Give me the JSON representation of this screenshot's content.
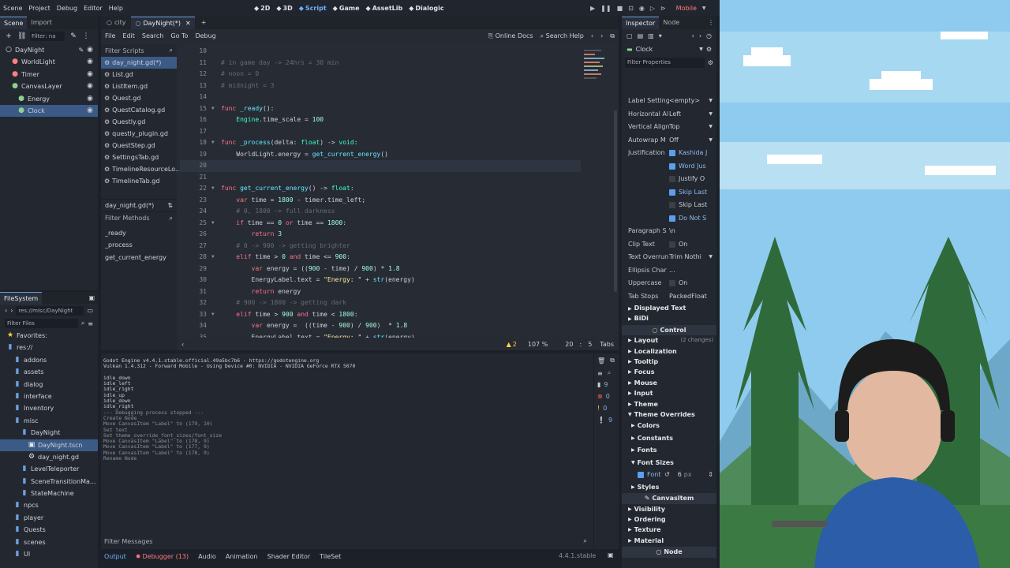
{
  "menu": [
    "Scene",
    "Project",
    "Debug",
    "Editor",
    "Help"
  ],
  "workspaces": [
    {
      "label": "2D",
      "icon": "2d-icon"
    },
    {
      "label": "3D",
      "icon": "3d-icon"
    },
    {
      "label": "Script",
      "icon": "script-icon",
      "active": true
    },
    {
      "label": "Game",
      "icon": "game-icon"
    },
    {
      "label": "AssetLib",
      "icon": "assetlib-icon"
    },
    {
      "label": "Dialogic",
      "icon": "dialogic-icon"
    }
  ],
  "renderer": "Mobile",
  "scene_dock": {
    "tabs": [
      "Scene",
      "Import"
    ],
    "filter_placeholder": "Filter: na",
    "tree": [
      {
        "label": "DayNight",
        "depth": 0,
        "icon": "node-icon"
      },
      {
        "label": "WorldLight",
        "depth": 1,
        "icon": "light-icon"
      },
      {
        "label": "Timer",
        "depth": 1,
        "icon": "timer-icon"
      },
      {
        "label": "CanvasLayer",
        "depth": 1,
        "icon": "canvaslayer-icon"
      },
      {
        "label": "Energy",
        "depth": 2,
        "icon": "label-icon"
      },
      {
        "label": "Clock",
        "depth": 2,
        "icon": "label-icon",
        "selected": true
      }
    ]
  },
  "filesystem": {
    "title": "FileSystem",
    "path": "res://misc/DayNight",
    "filter_placeholder": "Filter Files",
    "items": [
      {
        "label": "Favorites:",
        "depth": 0,
        "icon": "star-icon"
      },
      {
        "label": "res://",
        "depth": 0,
        "icon": "folder-icon"
      },
      {
        "label": "addons",
        "depth": 1,
        "icon": "folder-icon"
      },
      {
        "label": "assets",
        "depth": 1,
        "icon": "folder-icon"
      },
      {
        "label": "dialog",
        "depth": 1,
        "icon": "folder-icon"
      },
      {
        "label": "interface",
        "depth": 1,
        "icon": "folder-icon"
      },
      {
        "label": "Inventory",
        "depth": 1,
        "icon": "folder-icon"
      },
      {
        "label": "misc",
        "depth": 1,
        "icon": "folder-icon"
      },
      {
        "label": "DayNight",
        "depth": 2,
        "icon": "folder-icon"
      },
      {
        "label": "DayNight.tscn",
        "depth": 3,
        "icon": "scene-icon",
        "selected": true
      },
      {
        "label": "day_night.gd",
        "depth": 3,
        "icon": "script-file-icon"
      },
      {
        "label": "LevelTeleporter",
        "depth": 2,
        "icon": "folder-icon"
      },
      {
        "label": "SceneTransitionMa...",
        "depth": 2,
        "icon": "folder-icon"
      },
      {
        "label": "StateMachine",
        "depth": 2,
        "icon": "folder-icon"
      },
      {
        "label": "npcs",
        "depth": 1,
        "icon": "folder-icon"
      },
      {
        "label": "player",
        "depth": 1,
        "icon": "folder-icon"
      },
      {
        "label": "Quests",
        "depth": 1,
        "icon": "folder-icon"
      },
      {
        "label": "scenes",
        "depth": 1,
        "icon": "folder-icon"
      },
      {
        "label": "UI",
        "depth": 1,
        "icon": "folder-icon"
      }
    ]
  },
  "doc_tabs": [
    {
      "label": "city",
      "active": false
    },
    {
      "label": "DayNight(*)",
      "active": true
    }
  ],
  "script_menu": [
    "File",
    "Edit",
    "Search",
    "Go To",
    "Debug"
  ],
  "script_links": {
    "online_docs": "Online Docs",
    "search_help": "Search Help"
  },
  "scripts_list": {
    "filter_placeholder": "Filter Scripts",
    "items": [
      "day_night.gd(*)",
      "List.gd",
      "ListItem.gd",
      "Quest.gd",
      "QuestCatalog.gd",
      "Questly.gd",
      "questly_plugin.gd",
      "QuestStep.gd",
      "SettingsTab.gd",
      "TimelineResourceLo...",
      "TimelineTab.gd"
    ],
    "current": "day_night.gd(*)",
    "methods_placeholder": "Filter Methods",
    "methods": [
      "_ready",
      "_process",
      "get_current_energy"
    ]
  },
  "code": [
    {
      "n": "10",
      "t": ""
    },
    {
      "n": "11",
      "t": "# in game day -> 24hrs = 30 min"
    },
    {
      "n": "12",
      "t": "# noon = 0"
    },
    {
      "n": "13",
      "t": "# midnight = 3"
    },
    {
      "n": "14",
      "t": ""
    },
    {
      "n": "15",
      "t": "func _ready():"
    },
    {
      "n": "16",
      "t": "    Engine.time_scale = 100"
    },
    {
      "n": "17",
      "t": ""
    },
    {
      "n": "18",
      "t": "func _process(delta: float) -> void:"
    },
    {
      "n": "19",
      "t": "    WorldLight.energy = get_current_energy()"
    },
    {
      "n": "20",
      "t": ""
    },
    {
      "n": "21",
      "t": ""
    },
    {
      "n": "22",
      "t": "func get_current_energy() -> float:"
    },
    {
      "n": "23",
      "t": "    var time = 1800 - timer.time_left;"
    },
    {
      "n": "24",
      "t": "    # 0, 1800 -> full darkness"
    },
    {
      "n": "25",
      "t": "    if time == 0 or time == 1800:"
    },
    {
      "n": "26",
      "t": "        return 3"
    },
    {
      "n": "27",
      "t": "    # 0 -> 900 -> getting brighter"
    },
    {
      "n": "28",
      "t": "    elif time > 0 and time <= 900:"
    },
    {
      "n": "29",
      "t": "        var energy = ((900 - time) / 900) * 1.8"
    },
    {
      "n": "30",
      "t": "        EnergyLabel.text = \"Energy: \" + str(energy)"
    },
    {
      "n": "31",
      "t": "        return energy"
    },
    {
      "n": "32",
      "t": "    # 900 -> 1800 -> getting dark"
    },
    {
      "n": "33",
      "t": "    elif time > 900 and time < 1800:"
    },
    {
      "n": "34",
      "t": "        var energy =  ((time - 900) / 900)  * 1.8"
    },
    {
      "n": "35",
      "t": "        EnergyLabel.text = \"Energy: \" + str(energy)"
    }
  ],
  "status_bar": {
    "warnings": "2",
    "zoom": "107 %",
    "line": "20",
    "col": "5",
    "indent": "Tabs"
  },
  "output": {
    "lines": [
      "Godot Engine v4.4.1.stable.official.49a5bc7b6 - https://godotengine.org",
      "Vulkan 1.4.312 - Forward Mobile - Using Device #0: NVIDIA - NVIDIA GeForce RTX 5070",
      "",
      "idle_down",
      "idle_left",
      "idle_right",
      "idle_up",
      "idle_down",
      "idle_right",
      "--- Debugging process stopped ---",
      "Create Node",
      "Move CanvasItem \"Label\" to (179, 10)",
      "Set text",
      "Set theme_override_font_sizes/font_size",
      "Move CanvasItem \"Label\" to (178, 9)",
      "Move CanvasItem \"Label\" to (177, 9)",
      "Move CanvasItem \"Label\" to (178, 9)",
      "Rename Node"
    ],
    "filter_placeholder": "Filter Messages",
    "counts": [
      "9",
      "0",
      "0",
      "9"
    ]
  },
  "bottom_tabs": [
    "Output",
    "Debugger (13)",
    "Audio",
    "Animation",
    "Shader Editor",
    "TileSet"
  ],
  "version": "4.4.1.stable",
  "inspector": {
    "tabs": [
      "Inspector",
      "Node"
    ],
    "node_name": "Clock",
    "filter_placeholder": "Filter Properties",
    "props": [
      {
        "k": "Label Setting",
        "v": "<empty>",
        "type": "dropdown"
      },
      {
        "k": "Horizontal Al",
        "v": "Left",
        "type": "dropdown"
      },
      {
        "k": "Vertical Align",
        "v": "Top",
        "type": "dropdown"
      },
      {
        "k": "Autowrap M",
        "v": "Off",
        "type": "dropdown"
      },
      {
        "k": "Justification",
        "v": "Kashida J",
        "type": "check",
        "on": true
      },
      {
        "k": "",
        "v": "Word Jus",
        "type": "check",
        "on": true
      },
      {
        "k": "",
        "v": "Justify O",
        "type": "check",
        "on": false
      },
      {
        "k": "",
        "v": "Skip Last",
        "type": "check",
        "on": true
      },
      {
        "k": "",
        "v": "Skip Last",
        "type": "check",
        "on": false
      },
      {
        "k": "",
        "v": "Do Not S",
        "type": "check",
        "on": true
      },
      {
        "k": "Paragraph S",
        "v": "\\n",
        "type": "text"
      },
      {
        "k": "Clip Text",
        "v": "On",
        "type": "check",
        "on": false
      },
      {
        "k": "Text Overrun",
        "v": "Trim Nothi",
        "type": "dropdown"
      },
      {
        "k": "Ellipsis Char",
        "v": "...",
        "type": "text"
      },
      {
        "k": "Uppercase",
        "v": "On",
        "type": "check",
        "on": false
      },
      {
        "k": "Tab Stops",
        "v": "PackedFloat",
        "type": "text"
      }
    ],
    "sections_a": [
      "Displayed Text",
      "BiDi"
    ],
    "control_header": "Control",
    "sections_b": [
      {
        "label": "Layout",
        "extra": "(2 changes)"
      },
      {
        "label": "Localization"
      },
      {
        "label": "Tooltip"
      },
      {
        "label": "Focus"
      },
      {
        "label": "Mouse"
      },
      {
        "label": "Input"
      },
      {
        "label": "Theme"
      },
      {
        "label": "Theme Overrides",
        "open": true
      }
    ],
    "overrides": [
      "Colors",
      "Constants",
      "Fonts",
      "Font Sizes"
    ],
    "font_row": {
      "k": "Font",
      "v": "6",
      "unit": "px"
    },
    "styles": "Styles",
    "canvasitem_header": "CanvasItem",
    "sections_c": [
      "Visibility",
      "Ordering",
      "Texture",
      "Material"
    ],
    "node_header": "Node"
  },
  "colors": {
    "accent": "#6fa0e0",
    "selected": "#3b5a86",
    "panel": "#232830"
  }
}
